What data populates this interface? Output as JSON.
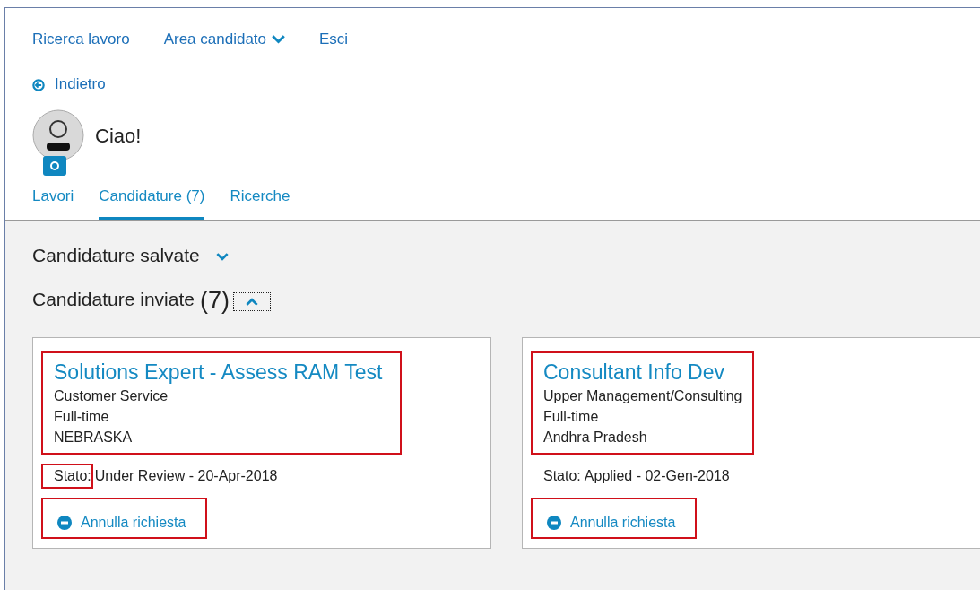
{
  "nav": [
    {
      "label": "Ricerca lavoro",
      "kind": "link"
    },
    {
      "label": "Area candidato",
      "kind": "dropdown"
    },
    {
      "label": "Esci",
      "kind": "link"
    }
  ],
  "back_link": "Indietro",
  "profile": {
    "greeting": "Ciao!"
  },
  "tabs": [
    {
      "label": "Lavori",
      "selected": false
    },
    {
      "label": "Candidature (7)",
      "selected": true
    },
    {
      "label": "Ricerche",
      "selected": false
    }
  ],
  "sections": [
    {
      "title": "Candidature salvate",
      "expanded": false,
      "focused": false
    },
    {
      "title": "Candidature inviate",
      "count": "(7)",
      "expanded": true,
      "focused": true
    }
  ],
  "applications": [
    {
      "title": "Solutions Expert - Assess RAM Test",
      "details": [
        "Customer Service",
        "Full-time",
        "NEBRASKA"
      ],
      "status_label": "Stato:",
      "status_value": "Under Review - 20-Apr-2018",
      "action": "Annulla richiesta",
      "header_highlighted": true,
      "status_label_highlighted": true,
      "action_highlighted": true
    },
    {
      "title": "Consultant Info Dev",
      "details": [
        "Upper Management/Consulting",
        "Full-time",
        "Andhra Pradesh"
      ],
      "status_label": "Stato:",
      "status_value": "Applied - 02-Gen-2018",
      "action": "Annulla richiesta",
      "header_highlighted": true,
      "status_label_highlighted": false,
      "action_highlighted": true
    }
  ]
}
